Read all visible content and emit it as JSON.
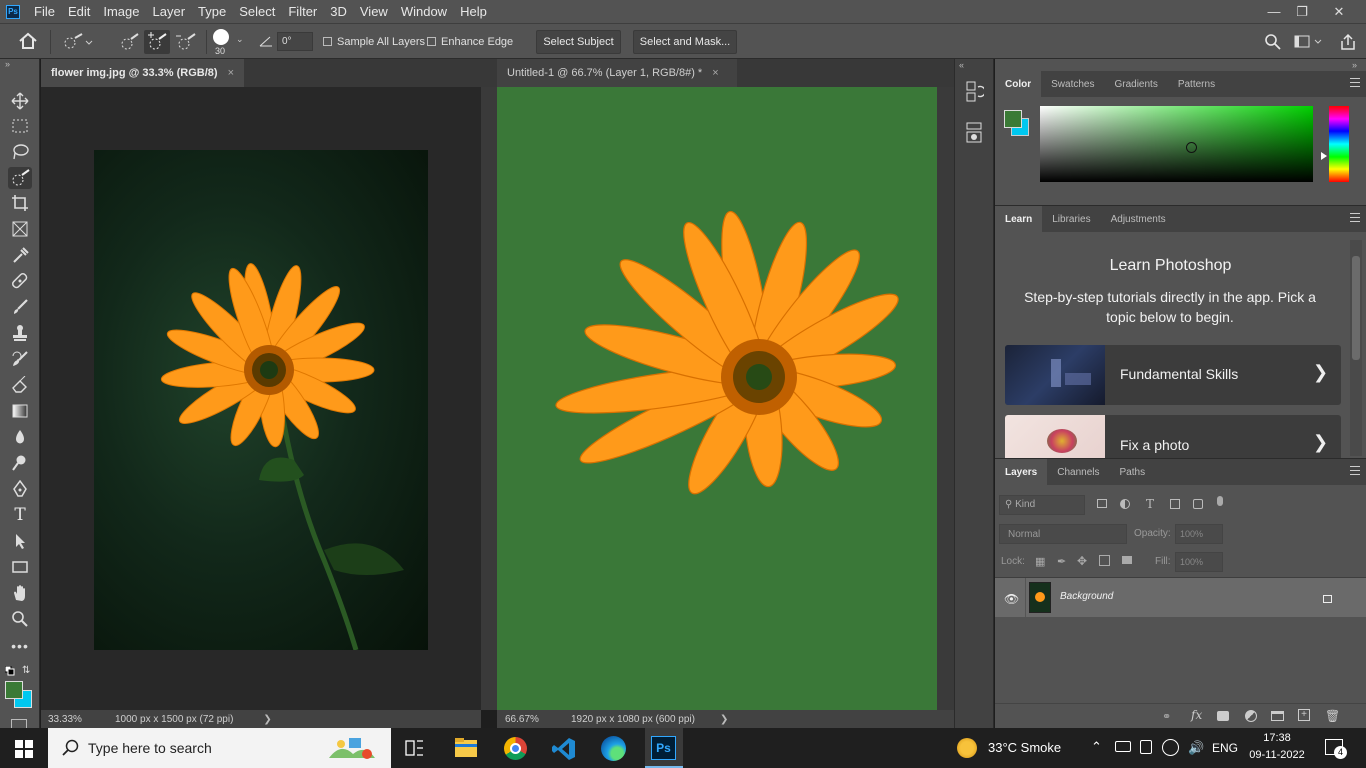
{
  "app": {
    "logo_text": "Ps"
  },
  "menu": [
    "File",
    "Edit",
    "Image",
    "Layer",
    "Type",
    "Select",
    "Filter",
    "3D",
    "View",
    "Window",
    "Help"
  ],
  "options_bar": {
    "brush_size": "30",
    "angle_value": "0°",
    "sample_all_layers": "Sample All Layers",
    "enhance_edge": "Enhance Edge",
    "select_subject": "Select Subject",
    "select_and_mask": "Select and Mask..."
  },
  "documents": [
    {
      "tab": "flower img.jpg @ 33.3% (RGB/8)",
      "zoom": "33.33%",
      "info": "1000 px x 1500 px (72 ppi)"
    },
    {
      "tab": "Untitled-1 @ 66.7% (Layer 1, RGB/8#) *",
      "zoom": "66.67%",
      "info": "1920 px x 1080 px (600 ppi)"
    }
  ],
  "colors": {
    "foreground": "#3a7a36",
    "background": "#00c8f0",
    "canvas_green": "#3a7838",
    "accent": "#2d8ceb"
  },
  "color_panel": {
    "tabs": [
      "Color",
      "Swatches",
      "Gradients",
      "Patterns"
    ]
  },
  "learn_panel": {
    "tabs": [
      "Learn",
      "Libraries",
      "Adjustments"
    ],
    "title": "Learn Photoshop",
    "subtitle": "Step-by-step tutorials directly in the app. Pick a topic below to begin.",
    "cards": [
      "Fundamental Skills",
      "Fix a photo"
    ]
  },
  "layers_panel": {
    "tabs": [
      "Layers",
      "Channels",
      "Paths"
    ],
    "kind": "Kind",
    "blend_mode": "Normal",
    "opacity_label": "Opacity:",
    "opacity_value": "100%",
    "lock_label": "Lock:",
    "fill_label": "Fill:",
    "fill_value": "100%",
    "layers": [
      {
        "name": "Background"
      }
    ]
  },
  "taskbar": {
    "search_placeholder": "Type here to search",
    "weather": "33°C  Smoke",
    "language": "ENG",
    "time": "17:38",
    "date": "09-11-2022",
    "notifications": "4"
  }
}
